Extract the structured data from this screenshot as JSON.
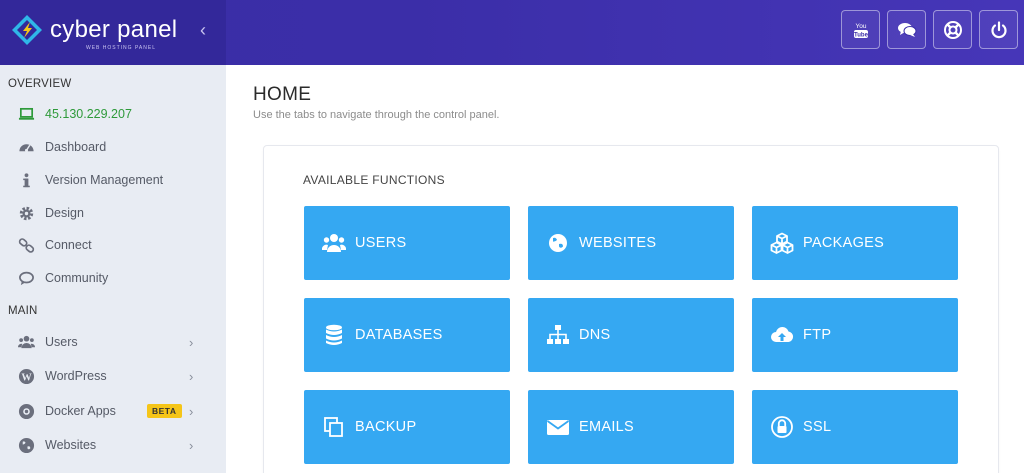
{
  "brand": {
    "name": "cyber panel",
    "subtitle": "WEB HOSTING PANEL"
  },
  "header_actions": [
    {
      "icon": "youtube-icon"
    },
    {
      "icon": "chat-icon"
    },
    {
      "icon": "support-icon"
    },
    {
      "icon": "power-icon"
    }
  ],
  "sidebar": {
    "overview_title": "OVERVIEW",
    "main_title": "MAIN",
    "overview_items": [
      {
        "label": "45.130.229.207",
        "icon": "laptop-icon"
      },
      {
        "label": "Dashboard",
        "icon": "dashboard-icon"
      },
      {
        "label": "Version Management",
        "icon": "info-icon"
      },
      {
        "label": "Design",
        "icon": "gear-icon"
      },
      {
        "label": "Connect",
        "icon": "link-icon"
      },
      {
        "label": "Community",
        "icon": "comment-icon"
      }
    ],
    "main_items": [
      {
        "label": "Users",
        "icon": "users-icon"
      },
      {
        "label": "WordPress",
        "icon": "wordpress-icon"
      },
      {
        "label": "Docker Apps",
        "icon": "docker-icon",
        "badge": "BETA"
      },
      {
        "label": "Websites",
        "icon": "globe-icon"
      }
    ]
  },
  "main": {
    "title": "HOME",
    "subtitle": "Use the tabs to navigate through the control panel.",
    "panel_title": "AVAILABLE FUNCTIONS",
    "tiles": [
      {
        "label": "USERS",
        "icon": "users-icon"
      },
      {
        "label": "WEBSITES",
        "icon": "globe-icon"
      },
      {
        "label": "PACKAGES",
        "icon": "cubes-icon"
      },
      {
        "label": "DATABASES",
        "icon": "database-icon"
      },
      {
        "label": "DNS",
        "icon": "sitemap-icon"
      },
      {
        "label": "FTP",
        "icon": "cloud-upload-icon"
      },
      {
        "label": "BACKUP",
        "icon": "copy-icon"
      },
      {
        "label": "EMAILS",
        "icon": "envelope-icon"
      },
      {
        "label": "SSL",
        "icon": "lock-icon"
      }
    ]
  },
  "colors": {
    "header": "#3b2ea8",
    "sidebar_bg": "#e8ecf3",
    "tile": "#35a8f2",
    "ip_text": "#2e9a3a",
    "badge": "#f5c518"
  }
}
